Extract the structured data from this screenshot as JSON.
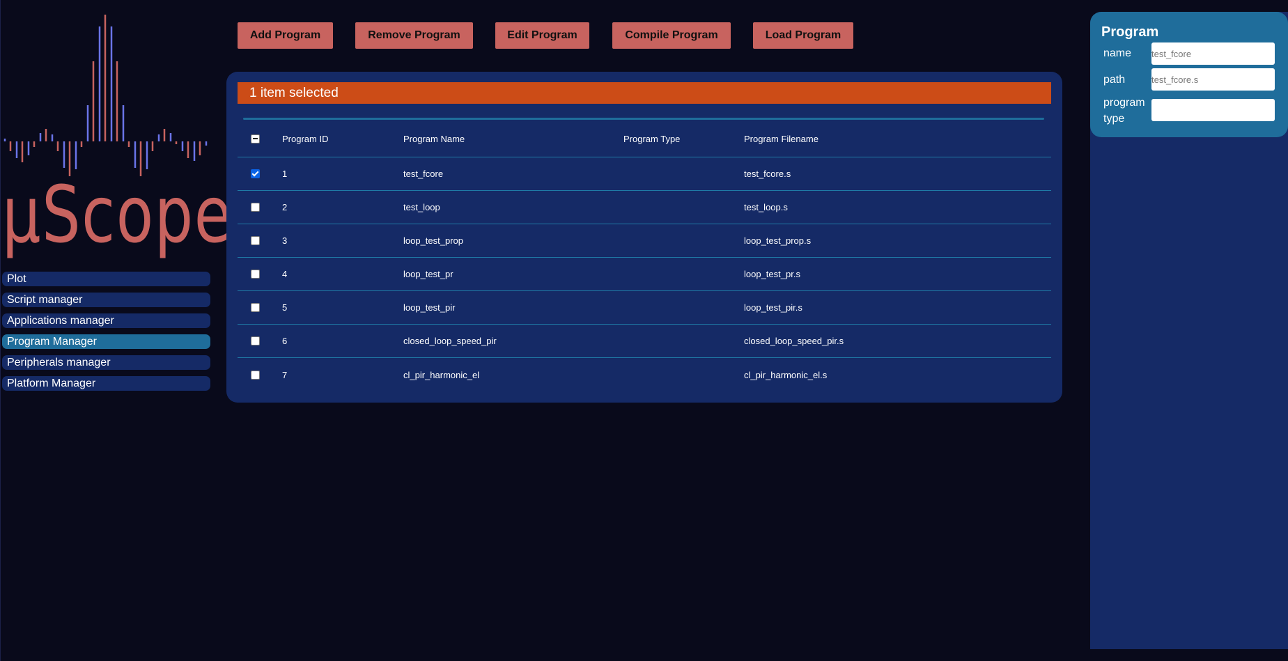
{
  "app": {
    "logo_text": "µScope",
    "accent": "#c8635f",
    "nav_bg": "#152a66",
    "active_bg": "#1f6d9b"
  },
  "sidebar": {
    "items": [
      {
        "label": "Plot",
        "active": false
      },
      {
        "label": "Script manager",
        "active": false
      },
      {
        "label": "Applications manager",
        "active": false
      },
      {
        "label": "Program Manager",
        "active": true
      },
      {
        "label": "Peripherals manager",
        "active": false
      },
      {
        "label": "Platform Manager",
        "active": false
      }
    ]
  },
  "toolbar": {
    "add": "Add Program",
    "remove": "Remove Program",
    "edit": "Edit Program",
    "compile": "Compile Program",
    "load": "Load Program"
  },
  "table": {
    "selection_text": "1 item selected",
    "selection_color": "#cc4c17",
    "columns": [
      "Program ID",
      "Program Name",
      "Program Type",
      "Program Filename"
    ],
    "rows": [
      {
        "id": "1",
        "name": "test_fcore",
        "type": "",
        "filename": "test_fcore.s",
        "checked": true
      },
      {
        "id": "2",
        "name": "test_loop",
        "type": "",
        "filename": "test_loop.s",
        "checked": false
      },
      {
        "id": "3",
        "name": "loop_test_prop",
        "type": "",
        "filename": "loop_test_prop.s",
        "checked": false
      },
      {
        "id": "4",
        "name": "loop_test_pr",
        "type": "",
        "filename": "loop_test_pr.s",
        "checked": false
      },
      {
        "id": "5",
        "name": "loop_test_pir",
        "type": "",
        "filename": "loop_test_pir.s",
        "checked": false
      },
      {
        "id": "6",
        "name": "closed_loop_speed_pir",
        "type": "",
        "filename": "closed_loop_speed_pir.s",
        "checked": false
      },
      {
        "id": "7",
        "name": "cl_pir_harmonic_el",
        "type": "",
        "filename": "cl_pir_harmonic_el.s",
        "checked": false
      }
    ]
  },
  "properties": {
    "title": "Program",
    "name_label": "name",
    "name_placeholder": "test_fcore",
    "path_label": "path",
    "path_placeholder": "test_fcore.s",
    "type_label": "program type",
    "type_value": ""
  }
}
